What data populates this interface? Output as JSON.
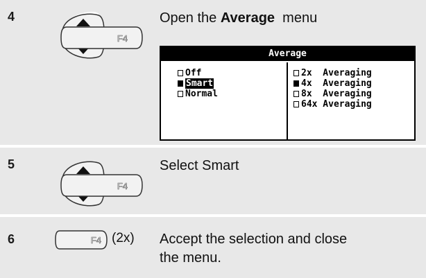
{
  "steps": [
    {
      "number": "4",
      "text_prefix": "Open the ",
      "text_bold": "Average",
      "text_suffix": "  menu",
      "menu": {
        "title": "Average",
        "left_options": [
          {
            "label": "Off",
            "checked": false,
            "highlighted": false
          },
          {
            "label": "Smart",
            "checked": true,
            "highlighted": true
          },
          {
            "label": "Normal",
            "checked": false,
            "highlighted": false
          }
        ],
        "right_options": [
          {
            "label": "2x  Averaging",
            "checked": false
          },
          {
            "label": "4x  Averaging",
            "checked": true
          },
          {
            "label": "8x  Averaging",
            "checked": false
          },
          {
            "label": "64x Averaging",
            "checked": false
          }
        ]
      },
      "key_label": "F4"
    },
    {
      "number": "5",
      "text": "Select Smart",
      "key_label": "F4"
    },
    {
      "number": "6",
      "text_line1": "Accept the selection and close",
      "text_line2": "the menu.",
      "key_label": "F4",
      "key_suffix": "(2x)"
    }
  ],
  "colors": {
    "row_background": "#e8e8e8",
    "key_fill": "#f0f0f0",
    "key_stroke": "#333333",
    "menu_title_bg": "#000000"
  }
}
